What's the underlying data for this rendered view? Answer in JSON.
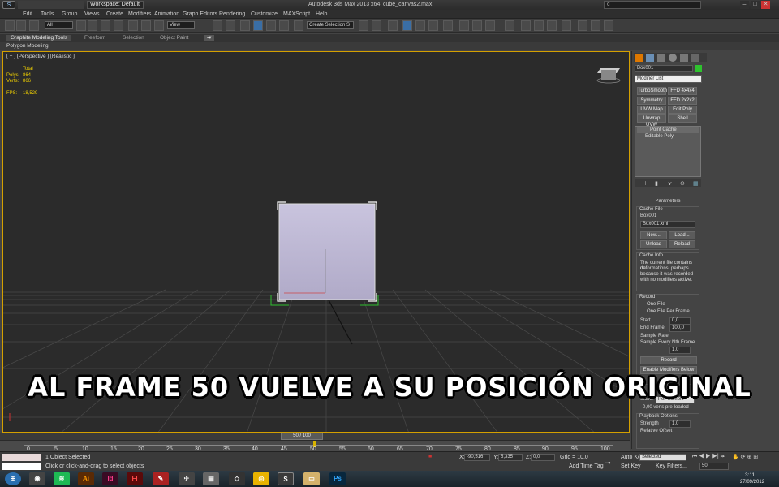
{
  "window": {
    "workspace": "Workspace: Default",
    "app_title": "Autodesk 3ds Max 2013 x64",
    "file_name": "cube_canvas2.max",
    "search_placeholder": "c",
    "controls": [
      "–",
      "□",
      "✕"
    ]
  },
  "menu": [
    "Edit",
    "Tools",
    "Group",
    "Views",
    "Create",
    "Modifiers",
    "Animation",
    "Graph Editors",
    "Rendering",
    "Customize",
    "MAXScript",
    "Help"
  ],
  "toolbar": {
    "filter": "All",
    "coord": "View",
    "selection_set": "Create Selection S"
  },
  "ribbon": {
    "tabs": [
      "Graphite Modeling Tools",
      "Freeform",
      "Selection",
      "Object Paint"
    ],
    "active_tab": "Graphite Modeling Tools",
    "sub": "Polygon Modeling"
  },
  "viewport": {
    "label": "[ + ] [Perspective ] [Realistic ]",
    "stats_header": "Total",
    "polys_label": "Polys:",
    "polys_value": "864",
    "verts_label": "Verts:",
    "verts_value": "866",
    "fps_label": "FPS:",
    "fps_value": "18,529"
  },
  "command_panel": {
    "object_name": "Box001",
    "object_color": "#2ec22e",
    "modifier_list": "Modifier List",
    "modifier_buttons": [
      "TurboSmooth",
      "FFD 4x4x4",
      "Symmetry",
      "FFD 2x2x2",
      "UVW Map",
      "Edit Poly",
      "Unwrap UVW",
      "Shell"
    ],
    "stack": [
      "Point Cache",
      "Editable Poly"
    ],
    "parameters_title": "Parameters",
    "cache_file_label": "Cache File",
    "cache_name": "Box001",
    "cache_file": "Box001.xml",
    "btn_new": "New...",
    "btn_load": "Load...",
    "btn_unload": "Unload",
    "btn_reload": "Reload",
    "cache_info_label": "Cache Info",
    "cache_info": [
      "The current file contains no",
      "deformations, perhaps",
      "because it was recorded",
      "with no modifiers active."
    ],
    "record_label": "Record",
    "radio_one_file": "One File",
    "radio_per_frame": "One File Per Frame",
    "start_label": "Start",
    "start_value": "0,0",
    "end_label": "End Frame",
    "end_value": "100,0",
    "sample_rate": "Sample Rate:",
    "sample_every": "Sample Every Nth Frame",
    "sample_value": "1,0",
    "btn_record": "Record",
    "btn_enable_mod": "Enable Modifiers Below",
    "slave_label": "Slave:",
    "slave_value": "Per-Sample",
    "slave_note": "0,00 verts pre-loaded",
    "playback_label": "Playback Options",
    "strength_label": "Strength",
    "strength_value": "1,0",
    "relative_offset": "Relative Offset"
  },
  "timeline": {
    "slider": "50 / 100",
    "ticks": [
      "0",
      "5",
      "10",
      "15",
      "20",
      "25",
      "30",
      "35",
      "40",
      "45",
      "50",
      "55",
      "60",
      "65",
      "70",
      "75",
      "80",
      "85",
      "90",
      "95",
      "100"
    ]
  },
  "status": {
    "selected": "1 Object Selected",
    "prompt": "Click or click-and-drag to select objects",
    "x_label": "X:",
    "x_value": "-90,516",
    "y_label": "Y:",
    "y_value": "5,335",
    "z_label": "Z:",
    "z_value": "0,0",
    "grid": "Grid = 10,0",
    "add_time_tag": "Add Time Tag",
    "auto_key": "Auto Key",
    "set_key": "Set Key",
    "key_mode": "Selected",
    "key_filters": "Key Filters...",
    "frame": "50"
  },
  "taskbar": {
    "clock": "3:11",
    "date": "27/09/2012",
    "apps": [
      "Ai",
      "Id",
      "Fl",
      "Ps"
    ]
  },
  "caption": "AL FRAME 50 VUELVE A SU POSICIÓN ORIGINAL"
}
